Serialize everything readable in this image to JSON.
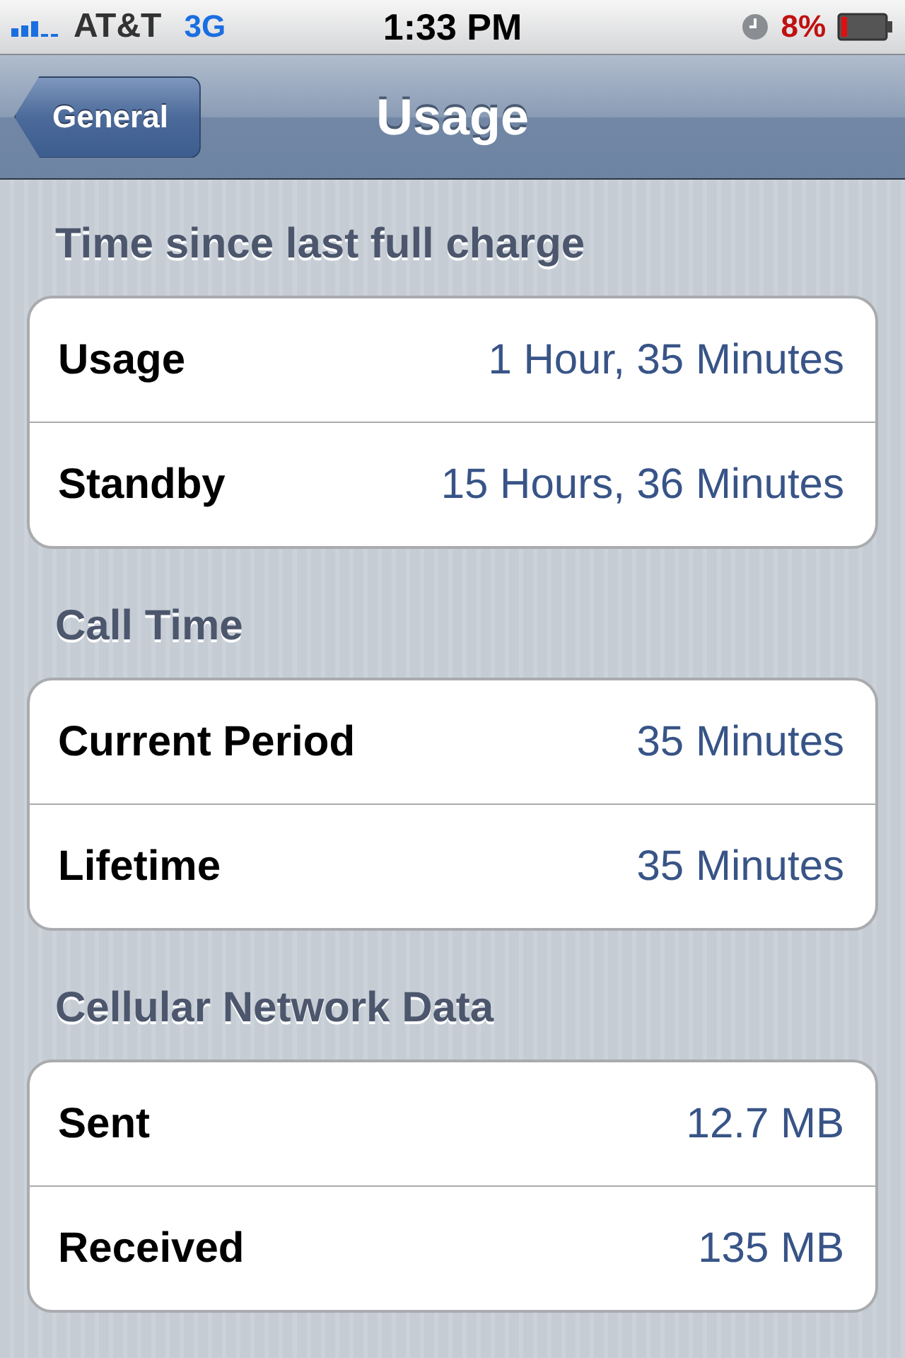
{
  "status_bar": {
    "carrier": "AT&T",
    "network": "3G",
    "time": "1:33 PM",
    "battery_percent": "8%"
  },
  "nav_bar": {
    "back_button": "General",
    "title": "Usage"
  },
  "sections": [
    {
      "header": "Time since last full charge",
      "rows": [
        {
          "label": "Usage",
          "value": "1 Hour, 35 Minutes"
        },
        {
          "label": "Standby",
          "value": "15 Hours, 36 Minutes"
        }
      ]
    },
    {
      "header": "Call Time",
      "rows": [
        {
          "label": "Current Period",
          "value": "35 Minutes"
        },
        {
          "label": "Lifetime",
          "value": "35 Minutes"
        }
      ]
    },
    {
      "header": "Cellular Network Data",
      "rows": [
        {
          "label": "Sent",
          "value": "12.7 MB"
        },
        {
          "label": "Received",
          "value": "135 MB"
        }
      ]
    }
  ]
}
